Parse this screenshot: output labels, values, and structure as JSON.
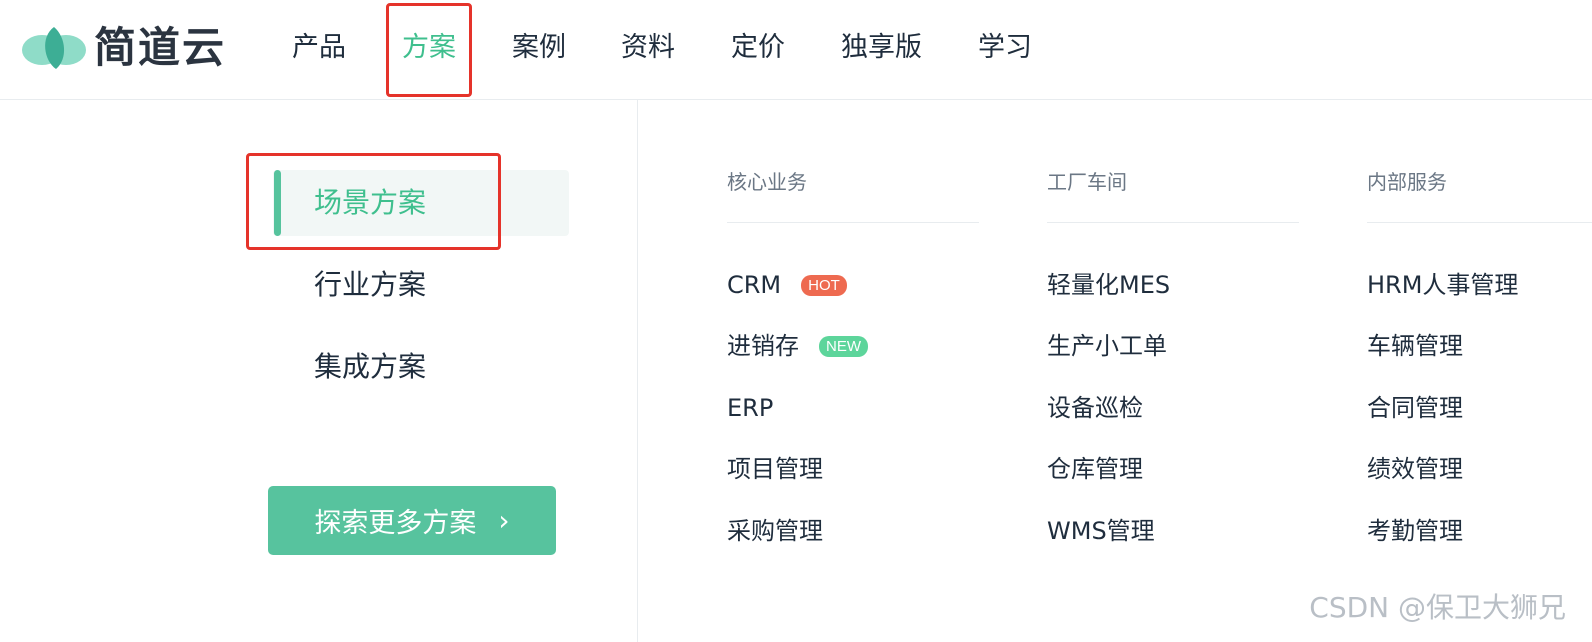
{
  "brand": {
    "name": "简道云"
  },
  "nav": [
    {
      "label": "产品"
    },
    {
      "label": "方案",
      "active": true
    },
    {
      "label": "案例"
    },
    {
      "label": "资料"
    },
    {
      "label": "定价"
    },
    {
      "label": "独享版"
    },
    {
      "label": "学习"
    }
  ],
  "categories": [
    {
      "label": "场景方案",
      "active": true
    },
    {
      "label": "行业方案"
    },
    {
      "label": "集成方案"
    }
  ],
  "explore_button": {
    "label": "探索更多方案",
    "icon": "chevron-right-icon"
  },
  "columns": [
    {
      "title": "核心业务",
      "items": [
        {
          "label": "CRM",
          "badge": "HOT"
        },
        {
          "label": "进销存",
          "badge": "NEW"
        },
        {
          "label": "ERP"
        },
        {
          "label": "项目管理"
        },
        {
          "label": "采购管理"
        }
      ]
    },
    {
      "title": "工厂车间",
      "items": [
        {
          "label": "轻量化MES"
        },
        {
          "label": "生产小工单"
        },
        {
          "label": "设备巡检"
        },
        {
          "label": "仓库管理"
        },
        {
          "label": "WMS管理"
        }
      ]
    },
    {
      "title": "内部服务",
      "items": [
        {
          "label": "HRM人事管理"
        },
        {
          "label": "车辆管理"
        },
        {
          "label": "合同管理"
        },
        {
          "label": "绩效管理"
        },
        {
          "label": "考勤管理"
        }
      ]
    }
  ],
  "watermark": "CSDN @保卫大狮兄",
  "colors": {
    "accent": "#3fbf8e",
    "button": "#57c39e",
    "highlight_box": "#e5332a",
    "hot_badge": "#ee6a50",
    "new_badge": "#5dd59b"
  }
}
